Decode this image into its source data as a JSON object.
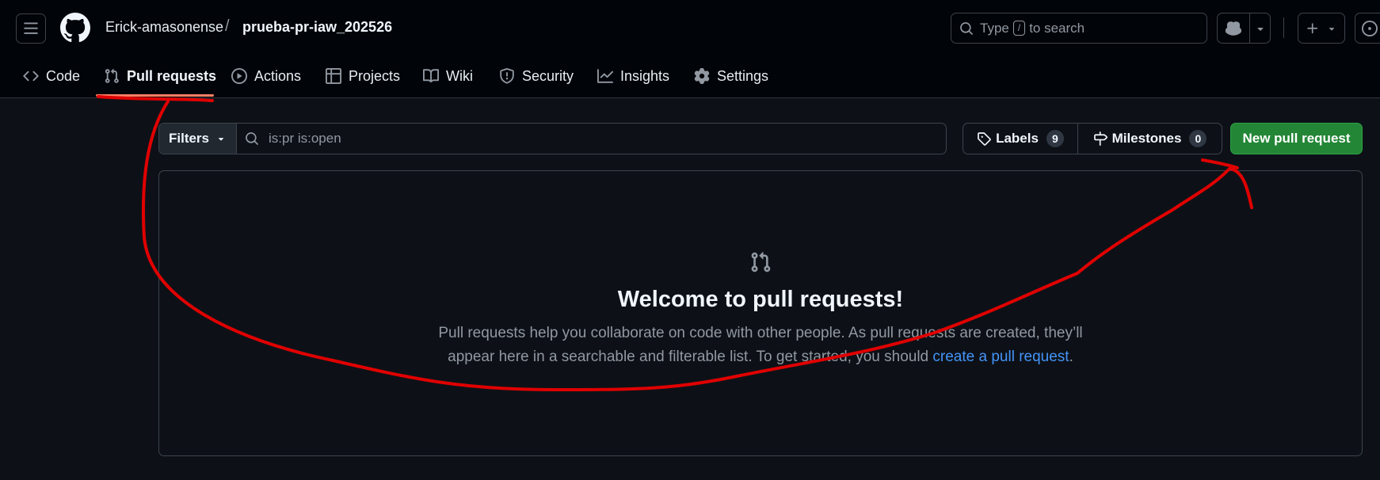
{
  "header": {
    "owner": "Erick-amasonense",
    "separator": "/",
    "repo": "prueba-pr-iaw_202526",
    "search": {
      "prefix": "Type",
      "key": "/",
      "suffix": "to search"
    }
  },
  "nav": {
    "tabs": [
      {
        "label": "Code",
        "icon": "code-icon"
      },
      {
        "label": "Pull requests",
        "icon": "git-pull-request-icon",
        "active": true
      },
      {
        "label": "Actions",
        "icon": "play-icon"
      },
      {
        "label": "Projects",
        "icon": "table-icon"
      },
      {
        "label": "Wiki",
        "icon": "book-icon"
      },
      {
        "label": "Security",
        "icon": "shield-icon"
      },
      {
        "label": "Insights",
        "icon": "graph-icon"
      },
      {
        "label": "Settings",
        "icon": "gear-icon"
      }
    ]
  },
  "toolbar": {
    "filters_label": "Filters",
    "query": "is:pr is:open",
    "labels_label": "Labels",
    "labels_count": "9",
    "milestones_label": "Milestones",
    "milestones_count": "0",
    "new_pr_label": "New pull request"
  },
  "blankslate": {
    "title": "Welcome to pull requests!",
    "line1": "Pull requests help you collaborate on code with other people. As pull requests are created, they’ll",
    "line2_prefix": "appear here in a searchable and filterable list. To get started, you should ",
    "link": "create a pull request",
    "line2_suffix": "."
  },
  "colors": {
    "background": "#0d1117",
    "header": "#010409",
    "accent_green": "#238636",
    "link_blue": "#4493f8",
    "active_underline": "#f78166",
    "annotation_red": "#e00000"
  }
}
